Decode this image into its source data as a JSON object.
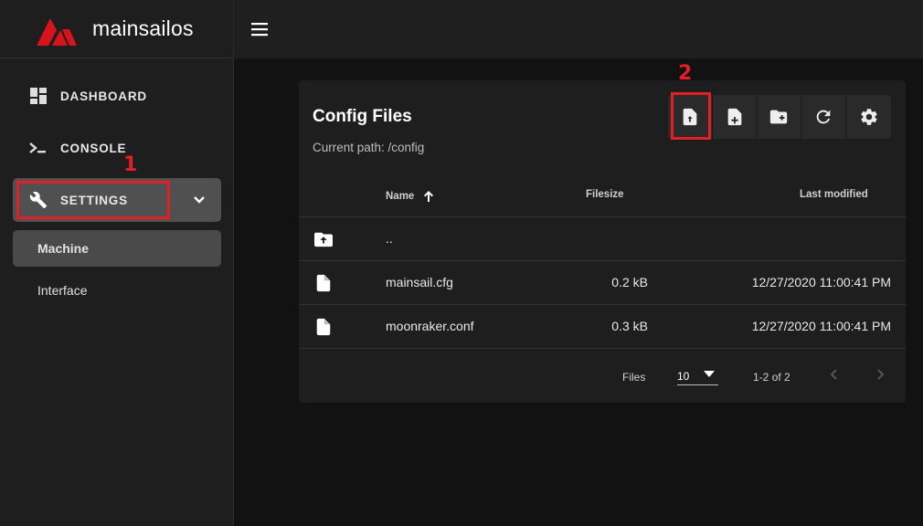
{
  "brand": {
    "name": "mainsailos",
    "accent": "#e31e24"
  },
  "sidebar": {
    "items": [
      {
        "label": "DASHBOARD",
        "icon": "dashboard-icon"
      },
      {
        "label": "CONSOLE",
        "icon": "console-icon"
      },
      {
        "label": "SETTINGS",
        "icon": "wrench-icon",
        "expanded": true
      }
    ],
    "subitems": [
      {
        "label": "Machine",
        "active": true
      },
      {
        "label": "Interface",
        "active": false
      }
    ]
  },
  "card": {
    "title": "Config Files",
    "path": "Current path: /config",
    "toolbar": [
      "upload-file-icon",
      "create-file-icon",
      "create-folder-icon",
      "refresh-icon",
      "settings-gear-icon"
    ],
    "columns": {
      "name": "Name",
      "size": "Filesize",
      "modified": "Last modified"
    },
    "rows": [
      {
        "name": "..",
        "icon": "folder-up-icon",
        "size": "",
        "modified": ""
      },
      {
        "name": "mainsail.cfg",
        "icon": "file-icon",
        "size": "0.2 kB",
        "modified": "12/27/2020 11:00:41 PM"
      },
      {
        "name": "moonraker.conf",
        "icon": "file-icon",
        "size": "0.3 kB",
        "modified": "12/27/2020 11:00:41 PM"
      }
    ],
    "footer": {
      "label": "Files",
      "per_page": "10",
      "range": "1-2 of 2"
    }
  },
  "annotations": {
    "one": "1",
    "two": "2"
  }
}
